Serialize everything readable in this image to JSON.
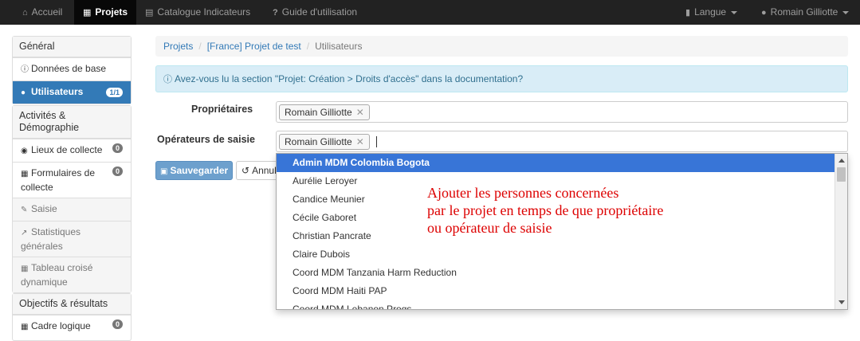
{
  "navbar": {
    "home": "Accueil",
    "projects": "Projets",
    "catalog": "Catalogue Indicateurs",
    "guide": "Guide d'utilisation",
    "language": "Langue",
    "user": "Romain Gilliotte"
  },
  "sidebar": {
    "general": {
      "heading": "Général",
      "items": [
        {
          "label": "Données de base"
        },
        {
          "label": "Utilisateurs",
          "badge": "1/1"
        }
      ]
    },
    "activities": {
      "heading": "Activités & Démographie",
      "items": [
        {
          "label": "Lieux de collecte",
          "badge": "0"
        },
        {
          "label": "Formulaires de collecte",
          "badge": "0"
        },
        {
          "label": "Saisie"
        },
        {
          "label": "Statistiques générales"
        },
        {
          "label": "Tableau croisé dynamique"
        }
      ]
    },
    "objectives": {
      "heading": "Objectifs & résultats",
      "items": [
        {
          "label": "Cadre logique",
          "badge": "0"
        }
      ]
    }
  },
  "breadcrumb": {
    "projects": "Projets",
    "project": "[France] Projet de test",
    "current": "Utilisateurs"
  },
  "alert": {
    "text": "Avez-vous lu la section \"Projet: Création > Droits d'accès\" dans la documentation?"
  },
  "form": {
    "owners_label": "Propriétaires",
    "owners": [
      "Romain Gilliotte"
    ],
    "operators_label": "Opérateurs de saisie",
    "operators": [
      "Romain Gilliotte"
    ],
    "save_label": "Sauvegarder",
    "cancel_label": "Annuler"
  },
  "dropdown": {
    "options": [
      "Admin MDM Colombia Bogota",
      "Aurélie Leroyer",
      "Candice Meunier",
      "Cécile Gaboret",
      "Christian Pancrate",
      "Claire Dubois",
      "Coord MDM Tanzania Harm Reduction",
      "Coord MDM Haiti PAP",
      "Coord MDM Lebanon Progs"
    ],
    "highlighted_index": 0
  },
  "annotation": {
    "lines": [
      "Ajouter les personnes concernées",
      "par le projet en temps de que propriétaire",
      "ou opérateur de saisie"
    ]
  },
  "colors": {
    "navbar": "#222222",
    "primary": "#337ab7",
    "highlight": "#3875d7",
    "annotation": "#dd0000"
  }
}
